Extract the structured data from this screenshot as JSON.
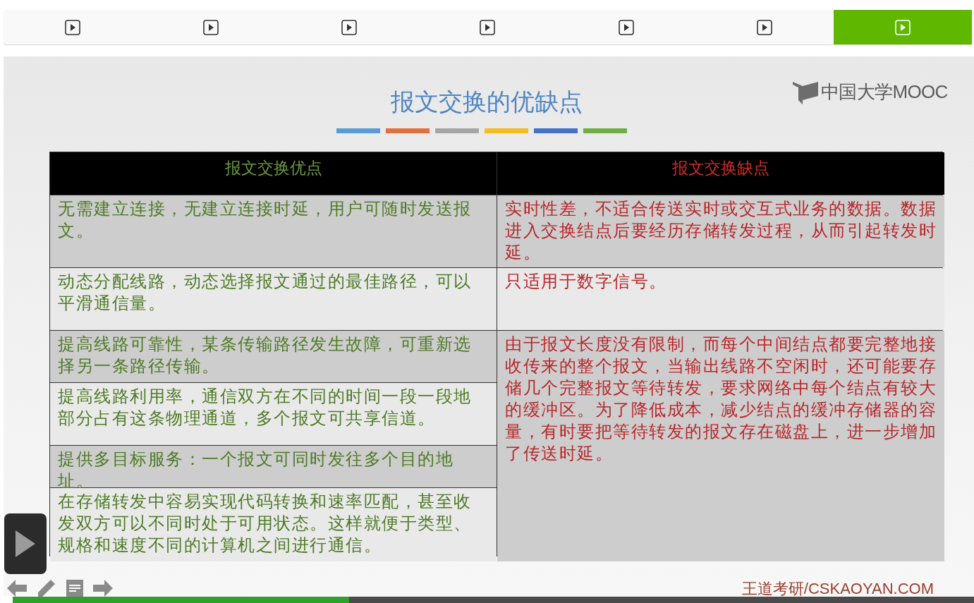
{
  "chapters": [
    {
      "selected": false
    },
    {
      "selected": false
    },
    {
      "selected": false
    },
    {
      "selected": false
    },
    {
      "selected": false
    },
    {
      "selected": false
    },
    {
      "selected": true
    }
  ],
  "slide": {
    "title": "报文交换的优缺点",
    "logo": "中国大学MOOC",
    "footer": "王道考研/CSKAOYAN.COM",
    "table": {
      "columns": [
        "报文交换优点",
        "报文交换缺点"
      ],
      "pros": [
        "无需建立连接，无建立连接时延，用户可随时发送报文。",
        "动态分配线路，动态选择报文通过的最佳路径，可以平滑通信量。",
        "提高线路可靠性，某条传输路径发生故障，可重新选择另一条路径传输。",
        "提高线路利用率，通信双方在不同的时间一段一段地部分占有这条物理通道，多个报文可共享信道。",
        "提供多目标服务：一个报文可同时发往多个目的地址。",
        "在存储转发中容易实现代码转换和速率匹配，甚至收发双方可以不同时处于可用状态。这样就便于类型、规格和速度不同的计算机之间进行通信。"
      ],
      "cons": [
        "实时性差，不适合传送实时或交互式业务的数据。数据进入交换结点后要经历存储转发过程，从而引起转发时延。",
        "只适用于数字信号。",
        "由于报文长度没有限制，而每个中间结点都要完整地接收传来的整个报文，当输出线路不空闲时，还可能要存储几个完整报文等待转发，要求网络中每个结点有较大的缓冲区。为了降低成本，减少结点的缓冲存储器的容量，有时要把等待转发的报文存在磁盘上，进一步增加了传送时延。"
      ]
    }
  },
  "progress": {
    "level": 0.35
  }
}
